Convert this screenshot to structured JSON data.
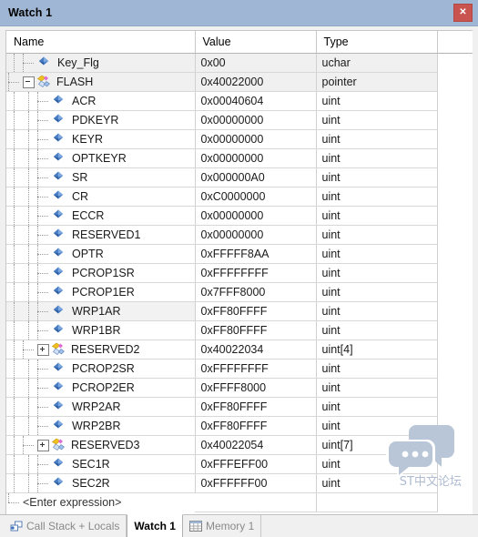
{
  "window": {
    "title": "Watch 1",
    "close_label": "✕",
    "close_icon": "close-icon",
    "titlebar_color": "#9fb6d4",
    "close_color": "#c9534f"
  },
  "grid": {
    "columns": [
      "Name",
      "Value",
      "Type",
      ""
    ],
    "rows": [
      {
        "name": "Key_Flg",
        "value": "0x00",
        "type": "uchar",
        "depth": 1,
        "icon": "variable-icon",
        "expander": "none",
        "shaded": true,
        "selected": false
      },
      {
        "name": "FLASH",
        "value": "0x40022000",
        "type": "pointer",
        "depth": 0,
        "icon": "struct-icon",
        "expander": "minus",
        "shaded": true,
        "selected": false
      },
      {
        "name": "ACR",
        "value": "0x00040604",
        "type": "uint",
        "depth": 2,
        "icon": "variable-icon",
        "expander": "none",
        "shaded": false,
        "selected": false
      },
      {
        "name": "PDKEYR",
        "value": "0x00000000",
        "type": "uint",
        "depth": 2,
        "icon": "variable-icon",
        "expander": "none",
        "shaded": false,
        "selected": false
      },
      {
        "name": "KEYR",
        "value": "0x00000000",
        "type": "uint",
        "depth": 2,
        "icon": "variable-icon",
        "expander": "none",
        "shaded": false,
        "selected": false
      },
      {
        "name": "OPTKEYR",
        "value": "0x00000000",
        "type": "uint",
        "depth": 2,
        "icon": "variable-icon",
        "expander": "none",
        "shaded": false,
        "selected": false
      },
      {
        "name": "SR",
        "value": "0x000000A0",
        "type": "uint",
        "depth": 2,
        "icon": "variable-icon",
        "expander": "none",
        "shaded": false,
        "selected": false
      },
      {
        "name": "CR",
        "value": "0xC0000000",
        "type": "uint",
        "depth": 2,
        "icon": "variable-icon",
        "expander": "none",
        "shaded": false,
        "selected": false
      },
      {
        "name": "ECCR",
        "value": "0x00000000",
        "type": "uint",
        "depth": 2,
        "icon": "variable-icon",
        "expander": "none",
        "shaded": false,
        "selected": false
      },
      {
        "name": "RESERVED1",
        "value": "0x00000000",
        "type": "uint",
        "depth": 2,
        "icon": "variable-icon",
        "expander": "none",
        "shaded": false,
        "selected": false
      },
      {
        "name": "OPTR",
        "value": "0xFFFFF8AA",
        "type": "uint",
        "depth": 2,
        "icon": "variable-icon",
        "expander": "none",
        "shaded": false,
        "selected": false
      },
      {
        "name": "PCROP1SR",
        "value": "0xFFFFFFFF",
        "type": "uint",
        "depth": 2,
        "icon": "variable-icon",
        "expander": "none",
        "shaded": false,
        "selected": false
      },
      {
        "name": "PCROP1ER",
        "value": "0x7FFF8000",
        "type": "uint",
        "depth": 2,
        "icon": "variable-icon",
        "expander": "none",
        "shaded": false,
        "selected": false
      },
      {
        "name": "WRP1AR",
        "value": "0xFF80FFFF",
        "type": "uint",
        "depth": 2,
        "icon": "variable-icon",
        "expander": "none",
        "shaded": false,
        "selected": true
      },
      {
        "name": "WRP1BR",
        "value": "0xFF80FFFF",
        "type": "uint",
        "depth": 2,
        "icon": "variable-icon",
        "expander": "none",
        "shaded": false,
        "selected": false
      },
      {
        "name": "RESERVED2",
        "value": "0x40022034",
        "type": "uint[4]",
        "depth": 1,
        "icon": "array-icon",
        "expander": "plus",
        "shaded": false,
        "selected": false
      },
      {
        "name": "PCROP2SR",
        "value": "0xFFFFFFFF",
        "type": "uint",
        "depth": 2,
        "icon": "variable-icon",
        "expander": "none",
        "shaded": false,
        "selected": false
      },
      {
        "name": "PCROP2ER",
        "value": "0xFFFF8000",
        "type": "uint",
        "depth": 2,
        "icon": "variable-icon",
        "expander": "none",
        "shaded": false,
        "selected": false
      },
      {
        "name": "WRP2AR",
        "value": "0xFF80FFFF",
        "type": "uint",
        "depth": 2,
        "icon": "variable-icon",
        "expander": "none",
        "shaded": false,
        "selected": false
      },
      {
        "name": "WRP2BR",
        "value": "0xFF80FFFF",
        "type": "uint",
        "depth": 2,
        "icon": "variable-icon",
        "expander": "none",
        "shaded": false,
        "selected": false
      },
      {
        "name": "RESERVED3",
        "value": "0x40022054",
        "type": "uint[7]",
        "depth": 1,
        "icon": "array-icon",
        "expander": "plus",
        "shaded": false,
        "selected": false
      },
      {
        "name": "SEC1R",
        "value": "0xFFFEFF00",
        "type": "uint",
        "depth": 2,
        "icon": "variable-icon",
        "expander": "none",
        "shaded": false,
        "selected": false
      },
      {
        "name": "SEC2R",
        "value": "0xFFFFFF00",
        "type": "uint",
        "depth": 2,
        "icon": "variable-icon",
        "expander": "none",
        "shaded": false,
        "selected": false
      },
      {
        "name": "<Enter expression>",
        "value": "",
        "type": "",
        "depth": 0,
        "icon": "none",
        "expander": "none",
        "shaded": false,
        "selected": false,
        "placeholder_row": true
      }
    ]
  },
  "watermark": {
    "text": "ST中文论坛",
    "icon": "chat-bubbles-icon",
    "color": "#aebbd0"
  },
  "tabbar": {
    "tabs": [
      {
        "label": "Call Stack + Locals",
        "icon": "call-stack-icon",
        "active": false
      },
      {
        "label": "Watch 1",
        "icon": "none",
        "active": true
      },
      {
        "label": "Memory 1",
        "icon": "memory-grid-icon",
        "active": false
      }
    ]
  }
}
